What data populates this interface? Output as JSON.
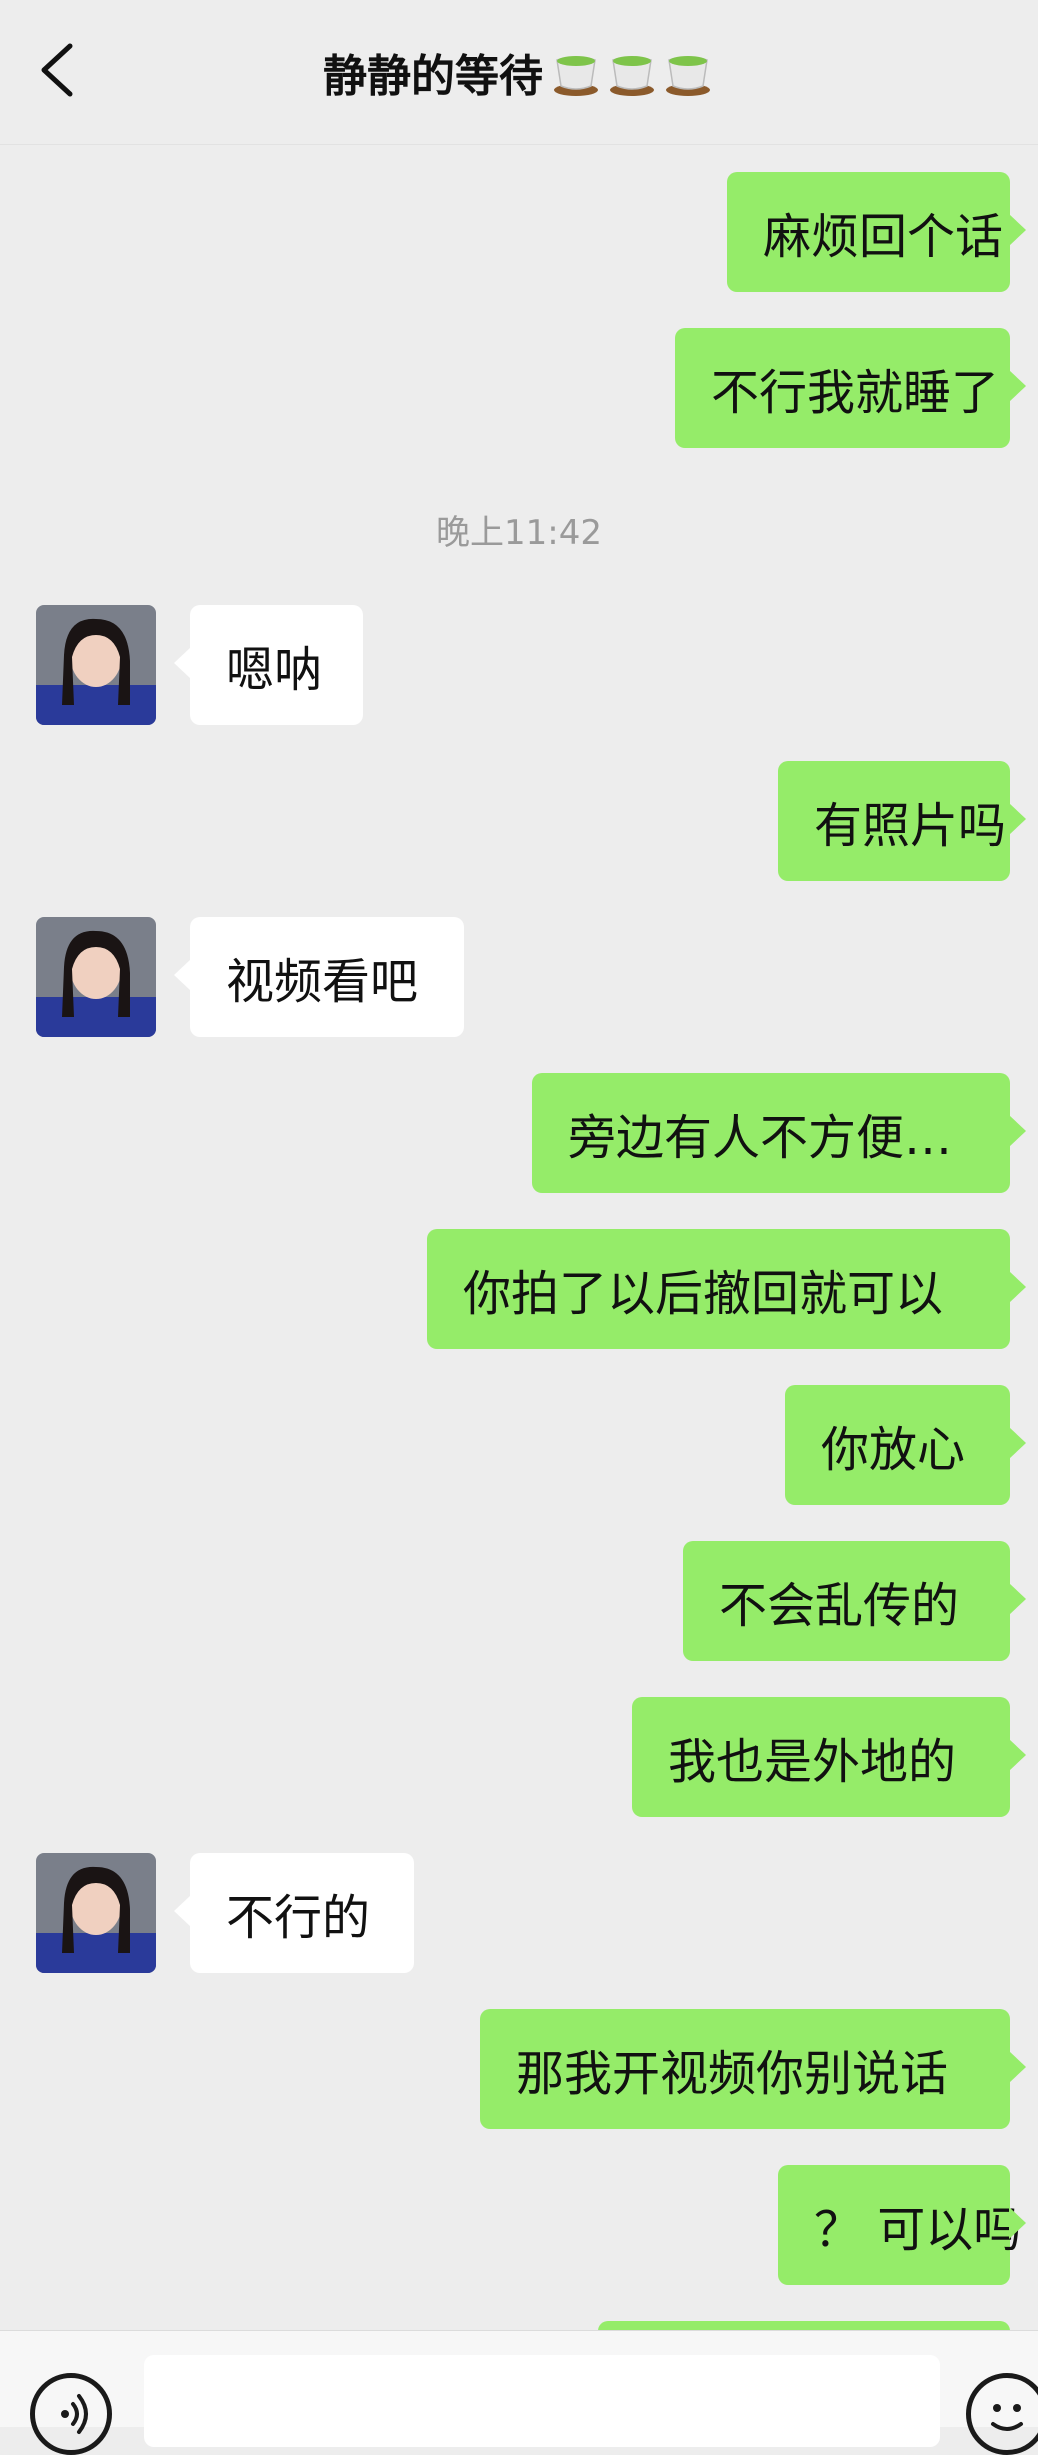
{
  "header": {
    "title": "静静的等待"
  },
  "timestamp": "晚上11:42",
  "messages": [
    {
      "side": "right",
      "text": "麻烦回个话"
    },
    {
      "side": "right",
      "text": "不行我就睡了"
    },
    {
      "side": "left",
      "text": "嗯呐"
    },
    {
      "side": "right",
      "text": "有照片吗"
    },
    {
      "side": "left",
      "text": "视频看吧"
    },
    {
      "side": "right",
      "text": "旁边有人不方便…"
    },
    {
      "side": "right",
      "text": "你拍了以后撤回就可以"
    },
    {
      "side": "right",
      "text": "你放心"
    },
    {
      "side": "right",
      "text": "不会乱传的"
    },
    {
      "side": "right",
      "text": "我也是外地的"
    },
    {
      "side": "left",
      "text": "不行的"
    },
    {
      "side": "right",
      "text": "那我开视频你别说话"
    },
    {
      "side": "right",
      "text": "？ 可以吗"
    }
  ],
  "input": {
    "value": "",
    "placeholder": ""
  },
  "colors": {
    "bubble_self": "#95ec69",
    "bubble_other": "#ffffff",
    "background": "#ededed"
  },
  "icons": {
    "back": "chevron-left-icon",
    "title_emoji": "green-tea-icon",
    "voice": "voice-icon",
    "emoji": "emoji-icon"
  }
}
